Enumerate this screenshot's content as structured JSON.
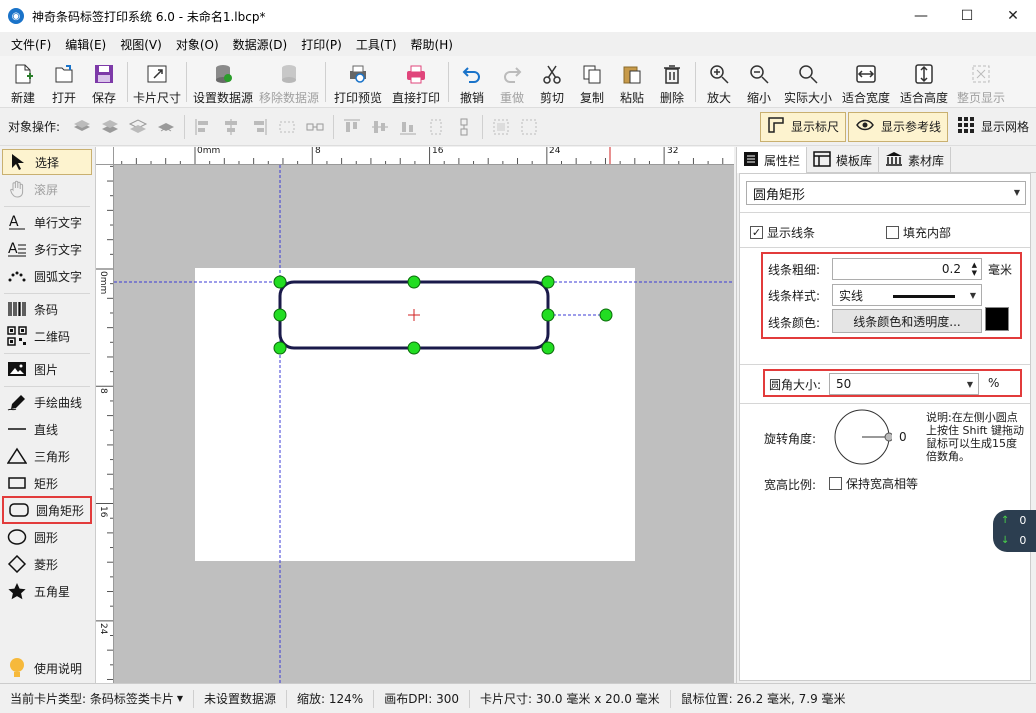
{
  "window": {
    "title": "神奇条码标签打印系统 6.0 - 未命名1.lbcp*",
    "minimize": "—",
    "maximize": "☐",
    "close": "✕"
  },
  "menu": [
    "文件(F)",
    "编辑(E)",
    "视图(V)",
    "对象(O)",
    "数据源(D)",
    "打印(P)",
    "工具(T)",
    "帮助(H)"
  ],
  "toolbar": {
    "new": "新建",
    "open": "打开",
    "save": "保存",
    "card_size": "卡片尺寸",
    "set_datasource": "设置数据源",
    "remove_datasource": "移除数据源",
    "print_preview": "打印预览",
    "direct_print": "直接打印",
    "undo": "撤销",
    "redo": "重做",
    "cut": "剪切",
    "copy": "复制",
    "paste": "粘贴",
    "delete": "删除",
    "zoom_in": "放大",
    "zoom_out": "缩小",
    "actual_size": "实际大小",
    "fit_width": "适合宽度",
    "fit_height": "适合高度",
    "full_page": "整页显示"
  },
  "ops": {
    "label": "对象操作:",
    "show_ruler": "显示标尺",
    "show_guides": "显示参考线",
    "show_grid": "显示网格"
  },
  "tools": [
    {
      "label": "选择",
      "icon": "cursor-icon"
    },
    {
      "label": "滚屏",
      "icon": "hand-icon"
    },
    {
      "label": "单行文字",
      "icon": "single-text-icon"
    },
    {
      "label": "多行文字",
      "icon": "multi-text-icon"
    },
    {
      "label": "圆弧文字",
      "icon": "arc-text-icon"
    },
    {
      "label": "条码",
      "icon": "barcode-icon"
    },
    {
      "label": "二维码",
      "icon": "qrcode-icon"
    },
    {
      "label": "图片",
      "icon": "image-icon"
    },
    {
      "label": "手绘曲线",
      "icon": "pen-icon"
    },
    {
      "label": "直线",
      "icon": "line-icon"
    },
    {
      "label": "三角形",
      "icon": "triangle-icon"
    },
    {
      "label": "矩形",
      "icon": "rectangle-icon"
    },
    {
      "label": "圆角矩形",
      "icon": "rounded-rect-icon"
    },
    {
      "label": "圆形",
      "icon": "circle-icon"
    },
    {
      "label": "菱形",
      "icon": "diamond-icon"
    },
    {
      "label": "五角星",
      "icon": "star-icon"
    },
    {
      "label": "使用说明",
      "icon": "lightbulb-icon"
    }
  ],
  "ruler": {
    "h_labels": [
      "0mm",
      "8",
      "16",
      "24",
      "32"
    ],
    "v_labels": [
      "0mm",
      "8",
      "16",
      "24"
    ]
  },
  "panel": {
    "tabs": [
      "属性栏",
      "模板库",
      "素材库"
    ],
    "object_type": "圆角矩形",
    "show_line": "显示线条",
    "fill_inside": "填充内部",
    "line_width_label": "线条粗细:",
    "line_width_value": "0.2",
    "line_width_unit": "毫米",
    "line_style_label": "线条样式:",
    "line_style_value": "实线",
    "line_color_label": "线条颜色:",
    "line_color_button": "线条颜色和透明度...",
    "line_color": "#000000",
    "corner_label": "圆角大小:",
    "corner_value": "50",
    "corner_unit": "%",
    "rotation_label": "旋转角度:",
    "rotation_value": "0",
    "rotation_note": "说明:在左侧小圆点上按住 Shift 键拖动鼠标可以生成15度倍数角。",
    "aspect_label": "宽高比例:",
    "keep_aspect": "保持宽高相等"
  },
  "badge": {
    "up": "0",
    "down": "0"
  },
  "status": {
    "card_type": "当前卡片类型: 条码标签类卡片",
    "datasource": "未设置数据源",
    "zoom": "缩放: 124%",
    "dpi": "画布DPI: 300",
    "card_size": "卡片尺寸: 30.0 毫米 x 20.0 毫米",
    "mouse": "鼠标位置: 26.2 毫米, 7.9 毫米"
  },
  "colors": {
    "accent_red": "#e23b3b",
    "handle_green": "#22dd22",
    "shape_stroke": "#1a1a4a",
    "guide_blue": "#3b3bd6"
  }
}
